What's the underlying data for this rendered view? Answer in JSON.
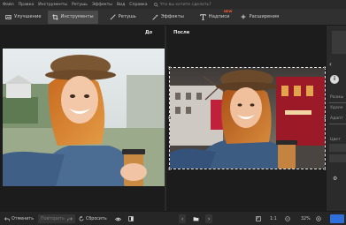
{
  "menu": {
    "items": [
      "Файл",
      "Правка",
      "Инструменты",
      "Ретушь",
      "Эффекты",
      "Вид",
      "Справка"
    ],
    "search_placeholder": "Что вы хотите сделать?"
  },
  "toolbar": {
    "tabs": [
      {
        "label": "Улучшение",
        "icon": "enhance-icon",
        "active": false
      },
      {
        "label": "Инструменты",
        "icon": "crop-icon",
        "active": true
      },
      {
        "label": "Ретушь",
        "icon": "brush-icon",
        "active": false
      },
      {
        "label": "Эффекты",
        "icon": "wand-icon",
        "active": false
      },
      {
        "label": "Надписи",
        "icon": "text-icon",
        "active": false
      },
      {
        "label": "Расширения",
        "icon": "plus-icon",
        "active": false
      }
    ],
    "new_badge": "NEW"
  },
  "view": {
    "before_label": "До",
    "after_label": "После"
  },
  "sidepanel": {
    "info_icon": "i",
    "rows": [
      "Размы",
      "Удале",
      "Адапт",
      "Цвет"
    ]
  },
  "bottombar": {
    "undo_label": "Отменить",
    "redo_label": "Повторить",
    "reset_label": "Сбросить",
    "zoom_ratio": "1:1",
    "zoom_percent": "32%"
  },
  "colors": {
    "accent_new": "#ff5a2c",
    "panel_bg": "#1c1c1c",
    "toolbar_bg": "#303030"
  }
}
